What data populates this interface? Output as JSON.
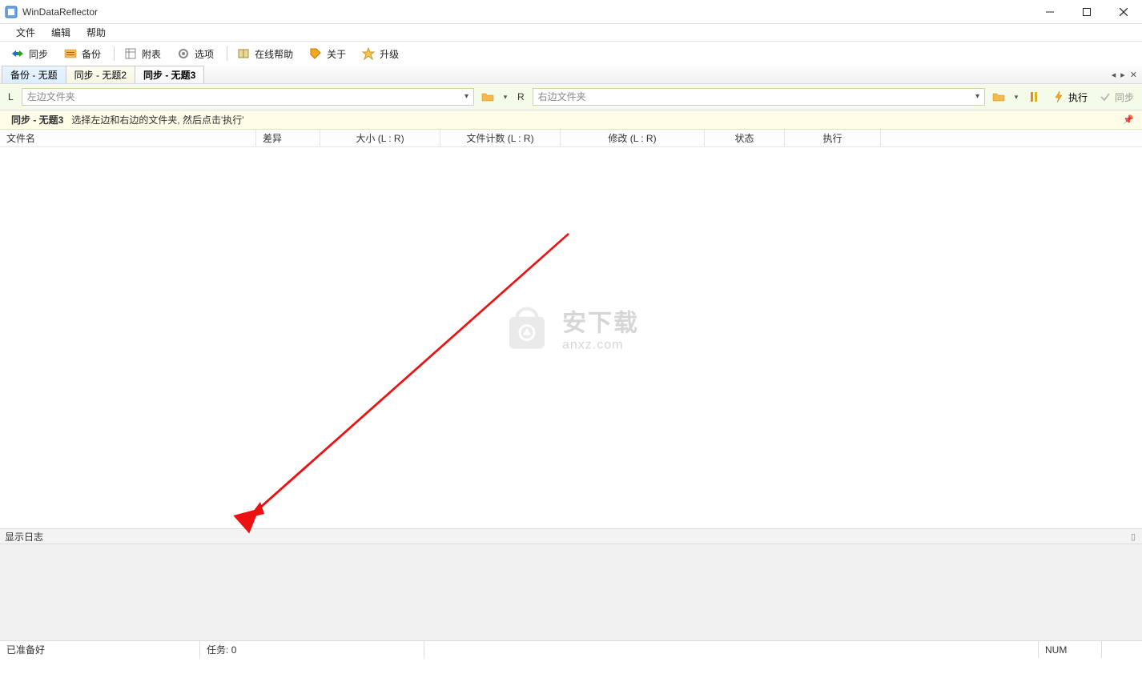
{
  "window": {
    "title": "WinDataReflector"
  },
  "menu": {
    "file": "文件",
    "edit": "编辑",
    "help": "帮助"
  },
  "toolbar": {
    "sync": "同步",
    "backup": "备份",
    "attach": "附表",
    "options": "选项",
    "onlinehelp": "在线帮助",
    "about": "关于",
    "upgrade": "升级"
  },
  "tabs": {
    "items": [
      {
        "label": "备份 - 无题"
      },
      {
        "label": "同步 - 无题2"
      },
      {
        "label": "同步 - 无题3"
      }
    ]
  },
  "path": {
    "left_label": "L",
    "left_placeholder": "左边文件夹",
    "right_label": "R",
    "right_placeholder": "右边文件夹",
    "run": "执行",
    "sync": "同步"
  },
  "hint": {
    "title": "同步 - 无题3",
    "text": "选择左边和右边的文件夹, 然后点击'执行'"
  },
  "columns": {
    "filename": "文件名",
    "diff": "差异",
    "size": "大小 (L : R)",
    "count": "文件计数 (L : R)",
    "modified": "修改 (L : R)",
    "status": "状态",
    "action": "执行"
  },
  "watermark": {
    "big": "安下载",
    "small": "anxz.com"
  },
  "log": {
    "title": "显示日志"
  },
  "status": {
    "ready": "已准备好",
    "tasks_label": "任务:",
    "tasks_value": "0",
    "num": "NUM"
  }
}
